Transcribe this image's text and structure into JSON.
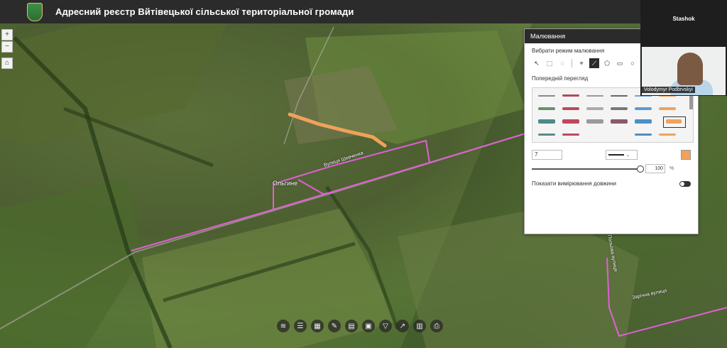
{
  "header": {
    "title": "Адресний реєстр Вйтівецької сільської територіальної громади"
  },
  "map": {
    "labels": {
      "village": "Ольгине",
      "street_a": "Вулиця Шевченка",
      "street_b": "Зарічна вулиця",
      "street_c": "Польова вулиця"
    },
    "zoom_in": "+",
    "zoom_out": "−",
    "home_icon": "home-icon"
  },
  "draw_panel": {
    "title": "Малювання",
    "mode_label": "Вибрати режим малювання",
    "preview_label": "Попередній перегляд",
    "width_value": "7",
    "opacity_value": "100",
    "opacity_unit": "%",
    "show_lengths_label": "Показати вимірювання довжини",
    "accent_color": "#f0a25a"
  },
  "video": {
    "host_name": "Stashok",
    "participant_name": "Volodymyr Podbrvskyi"
  },
  "toolbar": {
    "icons": [
      "layers-icon",
      "list-icon",
      "grid-icon",
      "draw-icon",
      "bookmark-icon",
      "print-icon",
      "filter-icon",
      "share-icon",
      "table-icon",
      "measure-icon"
    ]
  }
}
